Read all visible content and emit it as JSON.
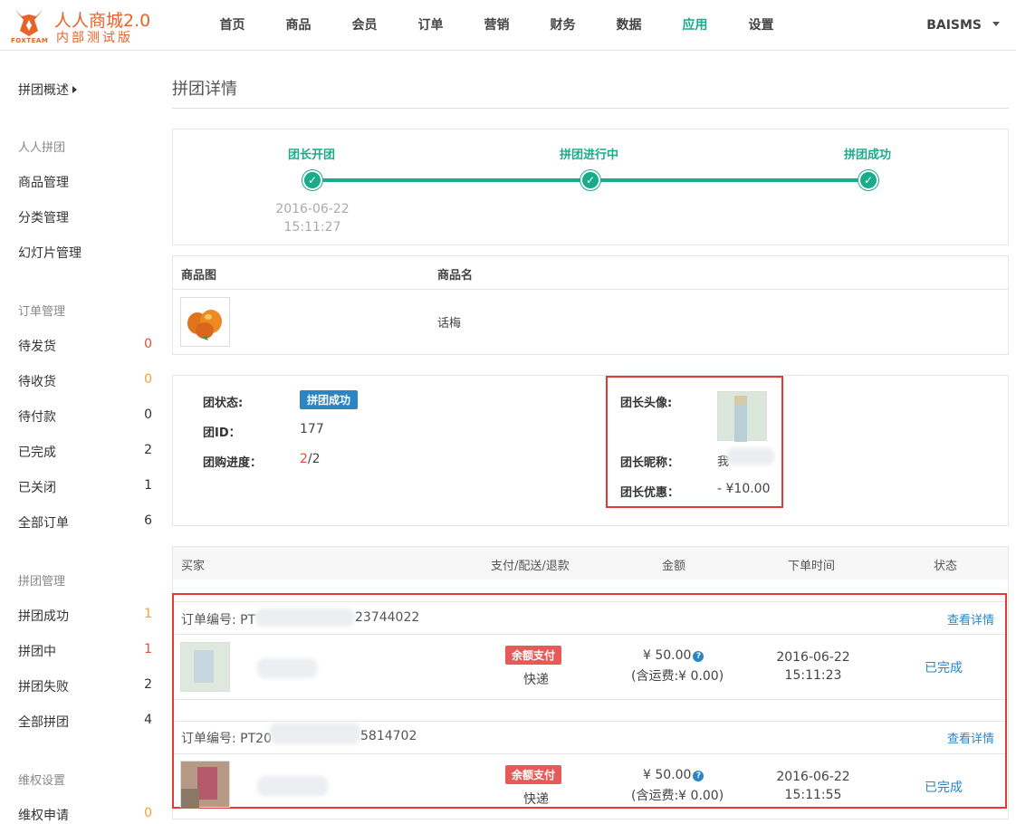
{
  "header": {
    "brand_small": "FOXTEAM",
    "title": "人人商城2.0",
    "subtitle": "内部测试版",
    "nav": [
      "首页",
      "商品",
      "会员",
      "订单",
      "营销",
      "财务",
      "数据",
      "应用",
      "设置"
    ],
    "active_nav": "应用",
    "user": "BAISMS"
  },
  "sidebar": {
    "overview": "拼团概述",
    "groups": [
      {
        "title": "人人拼团",
        "items": [
          {
            "label": "商品管理"
          },
          {
            "label": "分类管理"
          },
          {
            "label": "幻灯片管理"
          }
        ]
      },
      {
        "title": "订单管理",
        "items": [
          {
            "label": "待发货",
            "count": "0"
          },
          {
            "label": "待收货",
            "count": "0"
          },
          {
            "label": "待付款",
            "count": "0"
          },
          {
            "label": "已完成",
            "count": "2"
          },
          {
            "label": "已关闭",
            "count": "1"
          },
          {
            "label": "全部订单",
            "count": "6"
          }
        ]
      },
      {
        "title": "拼团管理",
        "items": [
          {
            "label": "拼团成功",
            "count": "1"
          },
          {
            "label": "拼团中",
            "count": "1"
          },
          {
            "label": "拼团失败",
            "count": "2"
          },
          {
            "label": "全部拼团",
            "count": "4"
          }
        ]
      },
      {
        "title": "维权设置",
        "items": [
          {
            "label": "维权申请",
            "count": "0"
          }
        ]
      }
    ]
  },
  "page": {
    "title": "拼团详情",
    "timeline": {
      "steps": [
        "团长开团",
        "拼团进行中",
        "拼团成功"
      ],
      "start_date": "2016-06-22",
      "start_time": "15:11:27",
      "check": "✓"
    },
    "product_table": {
      "headers": [
        "商品图",
        "商品名"
      ],
      "row": {
        "name": "话梅"
      }
    },
    "group_info": {
      "status_label": "团状态:",
      "status_value": "拼团成功",
      "id_label": "团ID：",
      "id_value": "177",
      "progress_label": "团购进度：",
      "progress_done": "2",
      "progress_total": "/2",
      "leader_avatar_label": "团长头像:",
      "leader_nick_label": "团长昵称：",
      "leader_nick_value": "我",
      "leader_discount_label": "团长优惠：",
      "leader_discount_value": "- ¥10.00"
    },
    "orders_table": {
      "headers": [
        "买家",
        "支付/配送/退款",
        "金额",
        "下单时间",
        "状态"
      ],
      "orders": [
        {
          "order_no_prefix": "订单编号: PT",
          "order_no_suffix": "23744022",
          "view": "查看详情",
          "pay_badge": "余额支付",
          "delivery": "快递",
          "amount": "¥ 50.00",
          "shipping": "(含运费:¥ 0.00)",
          "date": "2016-06-22",
          "time": "15:11:23",
          "status": "已完成"
        },
        {
          "order_no_prefix": "订单编号: PT20",
          "order_no_suffix": "5814702",
          "view": "查看详情",
          "pay_badge": "余额支付",
          "delivery": "快递",
          "amount": "¥ 50.00",
          "shipping": "(含运费:¥ 0.00)",
          "date": "2016-06-22",
          "time": "15:11:55",
          "status": "已完成"
        }
      ]
    }
  },
  "colors": {
    "accent": "#1aab8a",
    "brand": "#e8632a",
    "link": "#2b85c4",
    "danger": "#e74c3c",
    "highlight_box": "#e53935"
  }
}
